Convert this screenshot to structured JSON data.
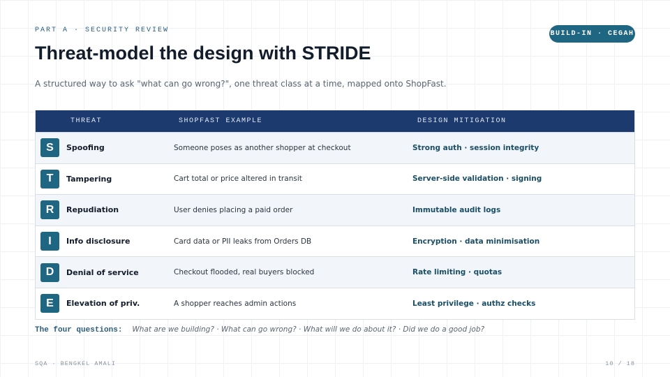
{
  "header": {
    "kicker": "PART A · SECURITY REVIEW",
    "badge": "BUILD-IN · CEGAH",
    "title": "Threat-model the design with STRIDE",
    "subtitle": "A structured way to ask \"what can go wrong?\", one threat class at a time, mapped onto ShopFast."
  },
  "table": {
    "columns": [
      "THREAT",
      "SHOPFAST EXAMPLE",
      "DESIGN MITIGATION"
    ],
    "rows": [
      {
        "letter": "S",
        "threat": "Spoofing",
        "example": "Someone poses as another shopper at checkout",
        "mitigation": "Strong auth · session integrity"
      },
      {
        "letter": "T",
        "threat": "Tampering",
        "example": "Cart total or price altered in transit",
        "mitigation": "Server-side validation · signing"
      },
      {
        "letter": "R",
        "threat": "Repudiation",
        "example": "User denies placing a paid order",
        "mitigation": "Immutable audit logs"
      },
      {
        "letter": "I",
        "threat": "Info disclosure",
        "example": "Card data or PII leaks from Orders DB",
        "mitigation": "Encryption · data minimisation"
      },
      {
        "letter": "D",
        "threat": "Denial of service",
        "example": "Checkout flooded, real buyers blocked",
        "mitigation": "Rate limiting · quotas"
      },
      {
        "letter": "E",
        "threat": "Elevation of priv.",
        "example": "A shopper reaches admin actions",
        "mitigation": "Least privilege · authz checks"
      }
    ]
  },
  "questions": {
    "label": "The four questions:",
    "text": "What are we building?  ·  What can go wrong?  ·  What will we do about it?  ·  Did we do a good job?"
  },
  "footer": {
    "left": "SQA · BENGKEL AMALI",
    "page": "10 / 18"
  },
  "colors": {
    "header_bg": "#1c3a6e",
    "accent": "#1f6682",
    "mitigation_text": "#1a4e66"
  }
}
